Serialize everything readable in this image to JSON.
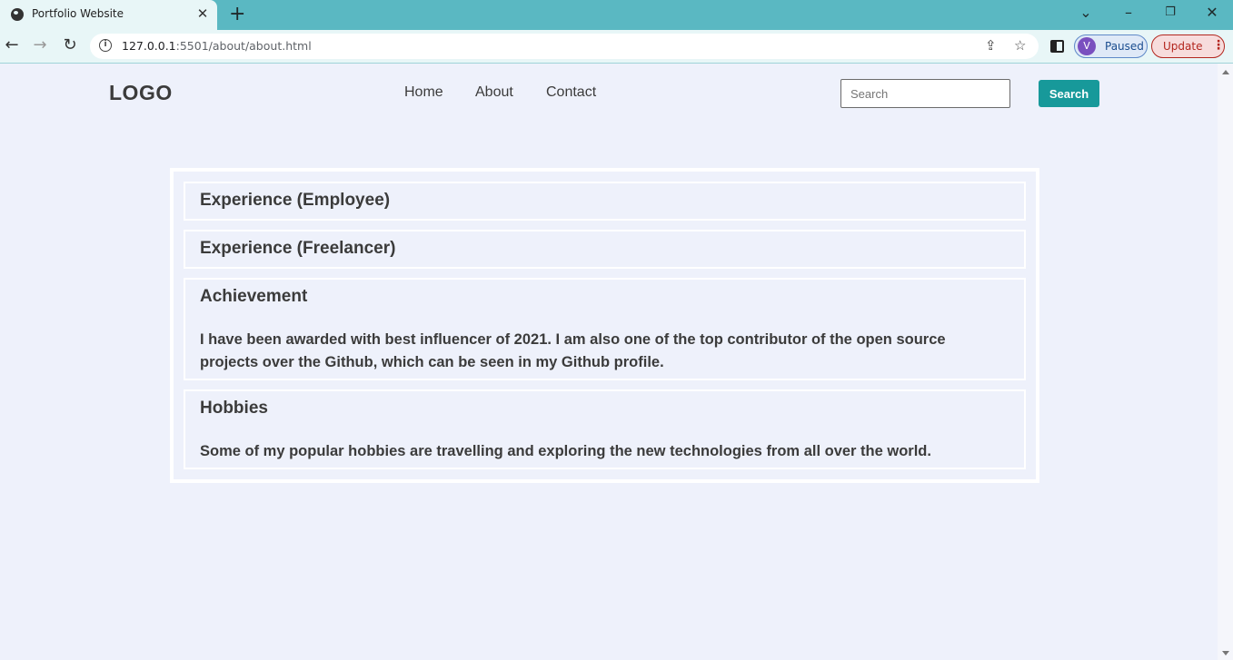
{
  "browser": {
    "tab_title": "Portfolio Website",
    "tab_close": "✕",
    "new_tab": "+",
    "url_host": "127.0.0.1",
    "url_path": ":5501/about/about.html",
    "profile_initial": "V",
    "profile_status": "Paused",
    "update_label": "Update"
  },
  "nav": {
    "logo": "LOGO",
    "links": [
      "Home",
      "About",
      "Contact"
    ],
    "search_placeholder": "Search",
    "search_button": "Search"
  },
  "sections": [
    {
      "title": "Experience (Employee)",
      "body": ""
    },
    {
      "title": "Experience (Freelancer)",
      "body": ""
    },
    {
      "title": "Achievement",
      "body": "I have been awarded with best influencer of 2021. I am also one of the top contributor of the open source projects over the Github, which can be seen in my Github profile."
    },
    {
      "title": "Hobbies",
      "body": "Some of my popular hobbies are travelling and exploring the new technologies from all over the world."
    }
  ],
  "colors": {
    "accent": "#17999a",
    "tabbar": "#5ab8c2",
    "page_background": "#eef1fb"
  }
}
